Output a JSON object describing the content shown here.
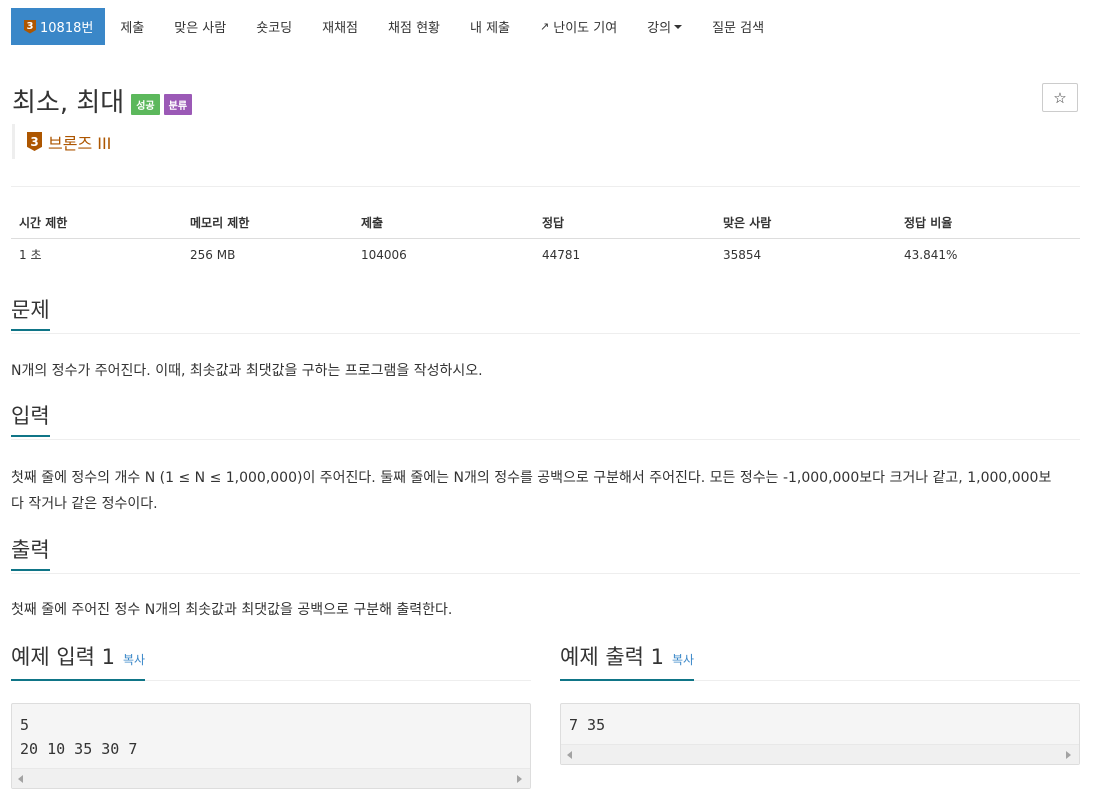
{
  "nav": {
    "tier_number": "3",
    "problem_id": "10818번",
    "items": [
      "제출",
      "맞은 사람",
      "숏코딩",
      "재채점",
      "채점 현황",
      "내 제출"
    ],
    "contribute": "난이도 기여",
    "lecture": "강의",
    "question_search": "질문 검색",
    "icons": {
      "external": "external-link-icon",
      "caret": "caret-down-icon"
    }
  },
  "problem": {
    "title": "최소, 최대",
    "label_success": "성공",
    "label_category": "분류",
    "star_icon": "☆",
    "tier_number": "3",
    "tier_text": "브론즈 III",
    "tier_color": "#ad5600"
  },
  "stats": {
    "headers": [
      "시간 제한",
      "메모리 제한",
      "제출",
      "정답",
      "맞은 사람",
      "정답 비율"
    ],
    "values": [
      "1 초",
      "256 MB",
      "104006",
      "44781",
      "35854",
      "43.841%"
    ]
  },
  "sections": {
    "description": {
      "title": "문제",
      "text": "N개의 정수가 주어진다. 이때, 최솟값과 최댓값을 구하는 프로그램을 작성하시오."
    },
    "input": {
      "title": "입력",
      "line1": "첫째 줄에 정수의 개수 N (1 ≤ N ≤ 1,000,000)이 주어진다. 둘째 줄에는 N개의 정수를 공백으로 구분해서 주어진다. 모든 정수는 -1,000,000보다 크거나 같고, 1,000,000보",
      "line2": "다 작거나 같은 정수이다."
    },
    "output": {
      "title": "출력",
      "text": "첫째 줄에 주어진 정수 N개의 최솟값과 최댓값을 공백으로 구분해 출력한다."
    }
  },
  "samples": {
    "input": {
      "title": "예제 입력 1",
      "copy": "복사",
      "lines": [
        "5",
        "20 10 35 30 7"
      ]
    },
    "output": {
      "title": "예제 출력 1",
      "copy": "복사",
      "lines": [
        "7 35"
      ]
    }
  },
  "colors": {
    "nav_active": "#3a87c8",
    "section_accent": "#0f7587",
    "success": "#5cb85c",
    "category": "#9b59b6"
  }
}
